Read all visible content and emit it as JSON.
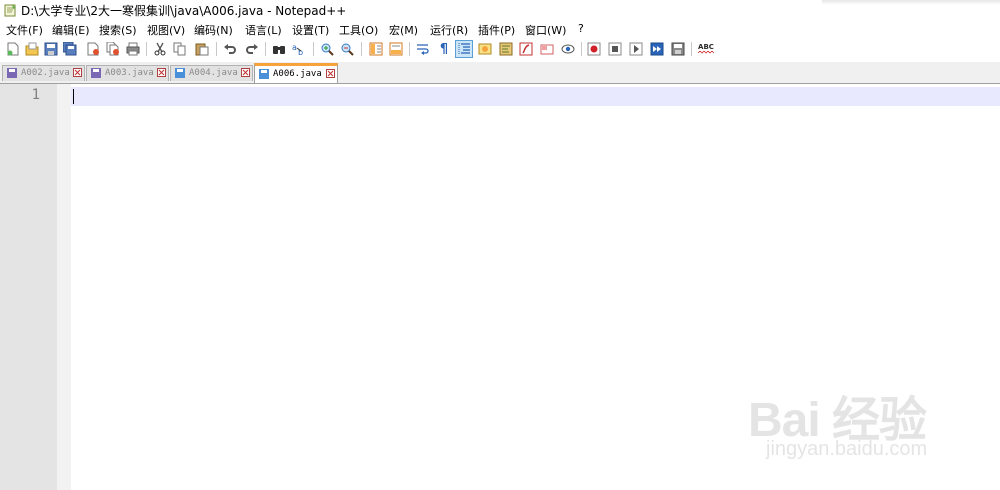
{
  "window": {
    "title": "D:\\大学专业\\2大一寒假集训\\java\\A006.java - Notepad++"
  },
  "menu": [
    "文件(F)",
    "编辑(E)",
    "搜索(S)",
    "视图(V)",
    "编码(N)",
    "语言(L)",
    "设置(T)",
    "工具(O)",
    "宏(M)",
    "运行(R)",
    "插件(P)",
    "窗口(W)",
    "?"
  ],
  "toolbar": {
    "spell_check_label": "ABC",
    "word_wrap_glyph": "¶",
    "buttons": [
      "new-file-icon",
      "open-file-icon",
      "save-icon",
      "save-all-icon",
      "close-icon",
      "close-all-icon",
      "print-icon",
      "cut-icon",
      "copy-icon",
      "paste-icon",
      "undo-icon",
      "redo-icon",
      "find-icon",
      "replace-icon",
      "zoom-in-icon",
      "zoom-out-icon",
      "sync-vertical-icon",
      "sync-horizontal-icon",
      "word-wrap-icon",
      "show-all-chars-icon",
      "indent-guide-icon",
      "user-language-icon",
      "doc-map-icon",
      "function-list-icon",
      "folder-workspace-icon",
      "monitoring-icon",
      "record-macro-icon",
      "stop-record-icon",
      "play-macro-icon",
      "run-macro-multiple-icon",
      "save-macro-icon",
      "spell-check-icon"
    ],
    "active_button": "indent-guide-icon"
  },
  "tabs": [
    {
      "label": "A002.java",
      "active": false
    },
    {
      "label": "A003.java",
      "active": false
    },
    {
      "label": "A004.java",
      "active": false
    },
    {
      "label": "A006.java",
      "active": true
    }
  ],
  "editor": {
    "line_numbers": [
      "1"
    ],
    "content": ""
  },
  "watermark": {
    "brand": "Bai 经验",
    "url": "jingyan.baidu.com"
  },
  "colors": {
    "active_tab_accent": "#f7a33c",
    "current_line_highlight": "#e8e8ff",
    "gutter_background": "#e4e4e4",
    "tab_icon_inactive": "#7b68b5",
    "tab_icon_active": "#4a90d9"
  }
}
